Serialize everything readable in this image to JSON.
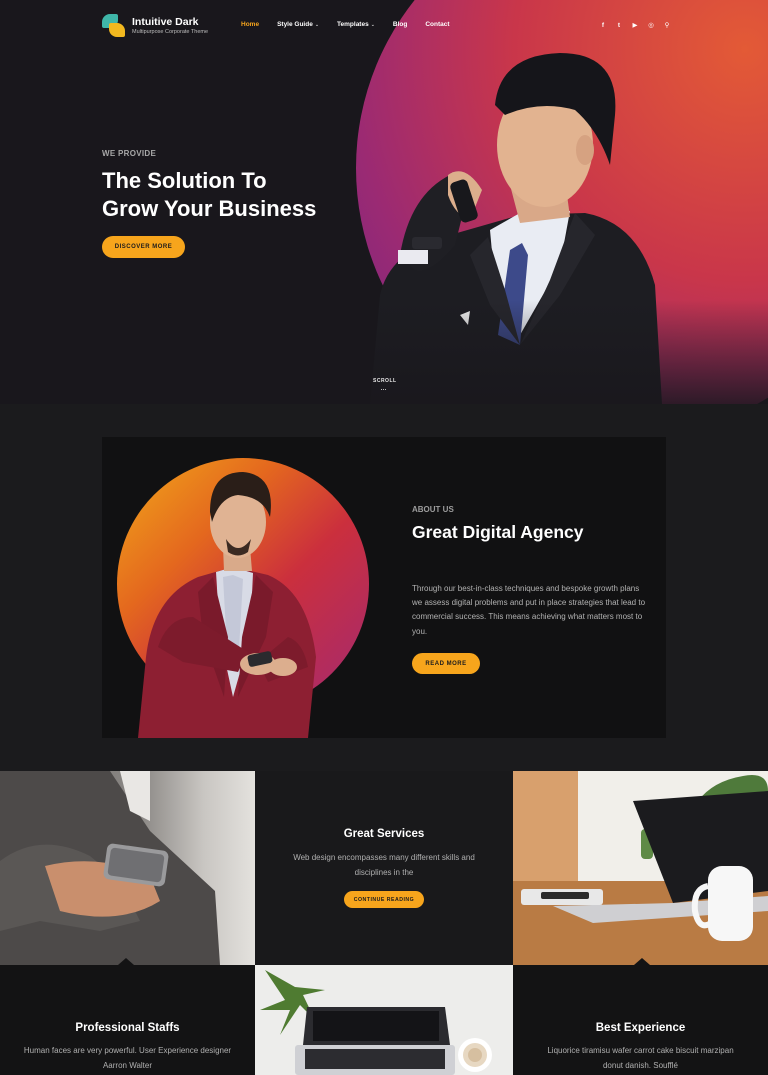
{
  "brand": {
    "name": "Intuitive Dark",
    "tagline": "Multipurpose Corporate Theme"
  },
  "nav": {
    "items": [
      {
        "label": "Home",
        "active": true,
        "dropdown": false
      },
      {
        "label": "Style Guide",
        "active": false,
        "dropdown": true
      },
      {
        "label": "Templates",
        "active": false,
        "dropdown": true
      },
      {
        "label": "Blog",
        "active": false,
        "dropdown": false
      },
      {
        "label": "Contact",
        "active": false,
        "dropdown": false
      }
    ],
    "chevron": "⌄"
  },
  "social": {
    "facebook": "f",
    "twitter": "t",
    "youtube": "▶",
    "dribbble": "◎",
    "search": "⚲"
  },
  "hero": {
    "eyebrow": "WE PROVIDE",
    "title_line1": "The Solution To",
    "title_line2": "Grow Your Business",
    "button": "DISCOVER MORE",
    "scroll": "SCROLL"
  },
  "about": {
    "eyebrow": "ABOUT US",
    "title": "Great Digital Agency",
    "text": "Through our best-in-class techniques and bespoke growth plans we assess digital problems and put in place strategies that lead to commercial success. This means achieving what matters most to you.",
    "button": "READ MORE"
  },
  "services": {
    "title": "Great Services",
    "text": "Web design encompasses many different skills and disciplines in the",
    "button": "CONTINUE READING"
  },
  "staffs": {
    "title": "Professional Staffs",
    "text": "Human faces are very powerful. User Experience designer Aarron Walter"
  },
  "experience": {
    "title": "Best Experience",
    "text": "Liquorice tiramisu wafer carrot cake biscuit marzipan donut danish. Soufflé"
  },
  "colors": {
    "accent": "#f7a51c",
    "background": "#1b1b1d",
    "panel": "#111112"
  }
}
